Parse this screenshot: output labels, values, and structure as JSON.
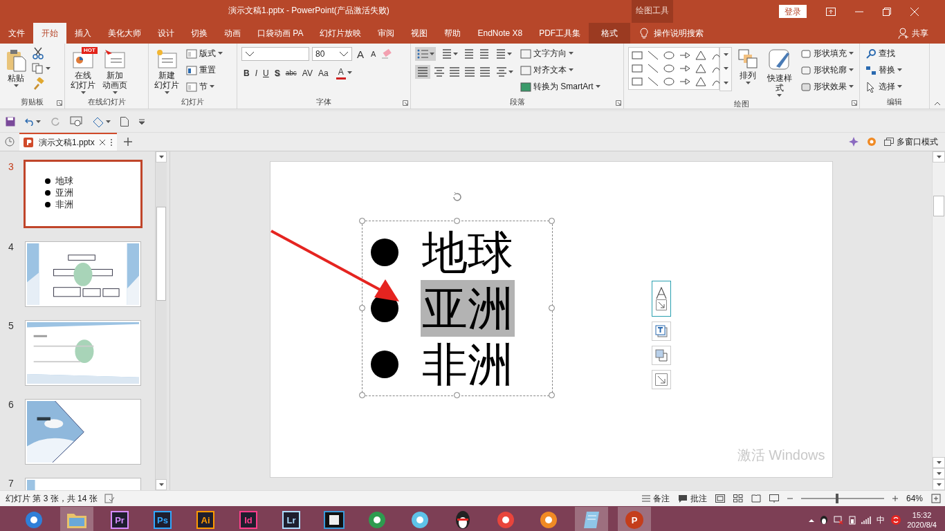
{
  "title_bar": {
    "title": "演示文稿1.pptx  -  PowerPoint(产品激活失败)",
    "context_label": "绘图工具",
    "login": "登录"
  },
  "menu_tabs": [
    {
      "label": "文件",
      "selected": false,
      "contextual": false
    },
    {
      "label": "开始",
      "selected": true,
      "contextual": false
    },
    {
      "label": "插入",
      "selected": false,
      "contextual": false
    },
    {
      "label": "美化大师",
      "selected": false,
      "contextual": false
    },
    {
      "label": "设计",
      "selected": false,
      "contextual": false
    },
    {
      "label": "切换",
      "selected": false,
      "contextual": false
    },
    {
      "label": "动画",
      "selected": false,
      "contextual": false
    },
    {
      "label": "口袋动画 PA",
      "selected": false,
      "contextual": false
    },
    {
      "label": "幻灯片放映",
      "selected": false,
      "contextual": false
    },
    {
      "label": "审阅",
      "selected": false,
      "contextual": false
    },
    {
      "label": "视图",
      "selected": false,
      "contextual": false
    },
    {
      "label": "帮助",
      "selected": false,
      "contextual": false
    },
    {
      "label": "EndNote X8",
      "selected": false,
      "contextual": false
    },
    {
      "label": "PDF工具集",
      "selected": false,
      "contextual": false
    },
    {
      "label": "格式",
      "selected": false,
      "contextual": true
    }
  ],
  "tell_me": "操作说明搜索",
  "share": "共享",
  "ribbon": [
    {
      "kind": "clipboard",
      "label": "剪贴板",
      "large": [
        {
          "label": "粘贴"
        }
      ]
    },
    {
      "kind": "online",
      "label": "在线幻灯片",
      "large": [
        {
          "label_lines": [
            "在线",
            "幻灯片"
          ],
          "badge": "HOT"
        },
        {
          "label_lines": [
            "新加",
            "动画页"
          ]
        }
      ]
    },
    {
      "kind": "slides",
      "label": "幻灯片",
      "large": [
        {
          "label_lines": [
            "新建",
            "幻灯片"
          ]
        }
      ],
      "small": [
        "版式",
        "重置",
        "节"
      ]
    },
    {
      "kind": "font",
      "label": "字体",
      "font_size": "80",
      "size_buttons": [
        "A",
        "A"
      ],
      "format_buttons": [
        "B",
        "I",
        "U",
        "S",
        "abc",
        "AV",
        "Aa"
      ],
      "color_button": "A"
    },
    {
      "kind": "paragraph",
      "label": "段落",
      "bullets_selected": true,
      "align_left_selected": true,
      "small": [
        "文字方向",
        "对齐文本",
        "转换为 SmartArt"
      ]
    },
    {
      "kind": "drawing",
      "label": "绘图",
      "large": [
        {
          "label": "排列"
        },
        {
          "label": "快速样式"
        }
      ],
      "small": [
        "形状填充",
        "形状轮廓",
        "形状效果"
      ]
    },
    {
      "kind": "editing",
      "label": "编辑",
      "small": [
        "查找",
        "替换",
        "选择"
      ]
    }
  ],
  "doc_tabs": [
    {
      "label": "演示文稿1.pptx",
      "selected": true
    }
  ],
  "multi_window": "多窗口模式",
  "slides": [
    {
      "number": "3",
      "selected": true,
      "kind": "text",
      "bullets": [
        "地球",
        "亚洲",
        "非洲"
      ]
    },
    {
      "number": "4",
      "selected": false,
      "kind": "picture"
    },
    {
      "number": "5",
      "selected": false,
      "kind": "picture"
    },
    {
      "number": "6",
      "selected": false,
      "kind": "picture"
    },
    {
      "number": "7",
      "selected": false,
      "kind": "picture"
    }
  ],
  "canvas": {
    "bullets": [
      {
        "text": "地球",
        "highlighted": false
      },
      {
        "text": "亚洲",
        "highlighted": true
      },
      {
        "text": "非洲",
        "highlighted": false
      }
    ],
    "activation_notice": "激活 Windows"
  },
  "status_bar": {
    "slide_info": "幻灯片 第 3 张，共 14 张",
    "notes": "备注",
    "comments": "批注",
    "zoom": {
      "label": "64%",
      "level": 0.42
    }
  },
  "taskbar": {
    "apps": [
      {
        "kind": "round",
        "color": "#2f7fd8",
        "active": false
      },
      {
        "kind": "folder",
        "color": "#e8c36a",
        "active": true
      },
      {
        "kind": "tile",
        "label": "Pr",
        "color": "#d58cff",
        "active": false
      },
      {
        "kind": "tile",
        "label": "Ps",
        "color": "#31a8ff",
        "active": false
      },
      {
        "kind": "tile",
        "label": "Ai",
        "color": "#ff9a00",
        "active": false
      },
      {
        "kind": "tile",
        "label": "Id",
        "color": "#ff3d8b",
        "active": false
      },
      {
        "kind": "tile",
        "label": "Lr",
        "color": "#addcff",
        "active": false
      },
      {
        "kind": "film",
        "color": "#3a9ad9",
        "active": false
      },
      {
        "kind": "round",
        "color": "#2e9b4f",
        "active": false
      },
      {
        "kind": "round",
        "color": "#5ec3e8",
        "active": false
      },
      {
        "kind": "penguin",
        "color": "#222222",
        "active": false
      },
      {
        "kind": "round",
        "color": "#e8453c",
        "active": false
      },
      {
        "kind": "round",
        "color": "#f08a24",
        "active": false
      },
      {
        "kind": "note",
        "color": "#8fc6e8",
        "active": true
      },
      {
        "kind": "tile",
        "label": "P",
        "color": "#c43e1c",
        "active": true
      }
    ],
    "ime": "中",
    "time": "15:32",
    "date": "2020/8/4"
  }
}
